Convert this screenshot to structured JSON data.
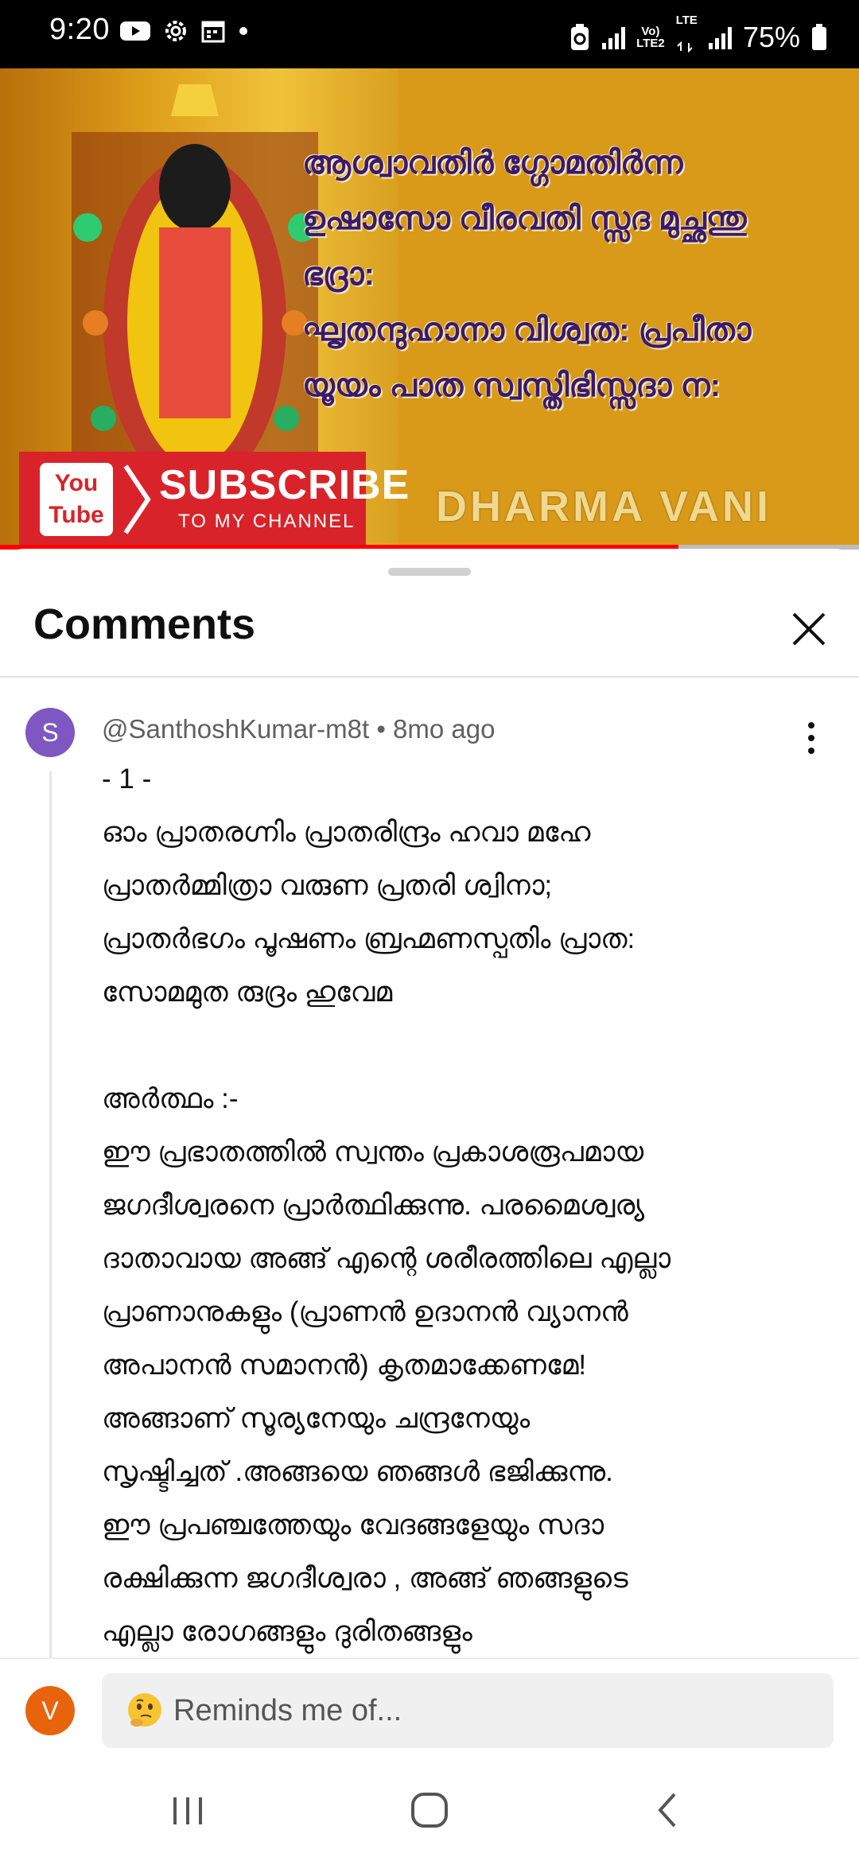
{
  "status_bar": {
    "time": "9:20",
    "network_label_top": "Vo)",
    "network_label_bottom": "LTE2",
    "lte_label": "LTE",
    "battery": "75%"
  },
  "video": {
    "verse_lines": [
      "ആശ്വാവതിർ ഗ്ഗോമതിർന്ന",
      "ഉഷാസോ വീരവതി സ്സദ മുച്ഛന്തു",
      "ഭദ്രാ:",
      "ഘൃതന്ദുഹാനാ വിശ്വത: പ്രപീതാ",
      "യൂയം പാത സ്വസ്തിഭിസ്സദാ ന:"
    ],
    "yt_logo_top": "You",
    "yt_logo_bottom": "Tube",
    "subscribe": "SUBSCRIBE",
    "subscribe_sub": "TO MY CHANNEL",
    "channel_watermark": "DHARMA VANI",
    "progress_fraction": 0.79
  },
  "comments_sheet": {
    "title": "Comments",
    "comment": {
      "avatar_letter": "S",
      "author": "@SanthoshKumar-m8t",
      "separator": "•",
      "age": "8mo ago",
      "lines": [
        "- 1 -",
        "ഓം പ്രാതരഗ്നിം പ്രാതരിന്ദ്രം ഹവാ മഹേ",
        "പ്രാതർമ്മിത്രാ വരുണ പ്രതരി ശ്വിനാ;",
        "പ്രാതർഭഗം പൂഷണം ബ്രഹ്മണസ്പതിം പ്രാത:",
        "സോമമുത രുദ്രം ഹുവേമ",
        "",
        "അർത്ഥം :-",
        "ഈ പ്രഭാതത്തിൽ സ്വന്തം പ്രകാശരൂപമായ",
        "ജഗദീശ്വരനെ പ്രാർത്ഥിക്കുന്നു. പരമൈശ്വര്യ",
        "ദാതാവായ അങ്ങ് എന്റെ ശരീരത്തിലെ എല്ലാ",
        "പ്രാണാനുകളും (പ്രാണൻ  ഉദാനൻ വ്യാനൻ",
        "അപാനൻ സമാനൻ) കൃതമാക്കേണമേ!",
        "അങ്ങാണ് സൂര്യനേയും ചന്ദ്രനേയും",
        "സൃഷ്ടിച്ചത് .അങ്ങയെ ഞങ്ങൾ ഭജിക്കുന്നു.",
        "ഈ പ്രപഞ്ചത്തേയും വേദങ്ങളേയും സദാ",
        "രക്ഷിക്കുന്ന ജഗദീശ്വരാ , അങ്ങ് ഞങ്ങളുടെ",
        "എല്ലാ രോഗങ്ങളും ദുരിതങ്ങളും"
      ]
    }
  },
  "input_bar": {
    "avatar_letter": "V",
    "placeholder": "Reminds me of..."
  },
  "colors": {
    "progress_red": "#ff0000",
    "avatar_purple": "#7e57c2",
    "avatar_orange": "#e8640c"
  }
}
